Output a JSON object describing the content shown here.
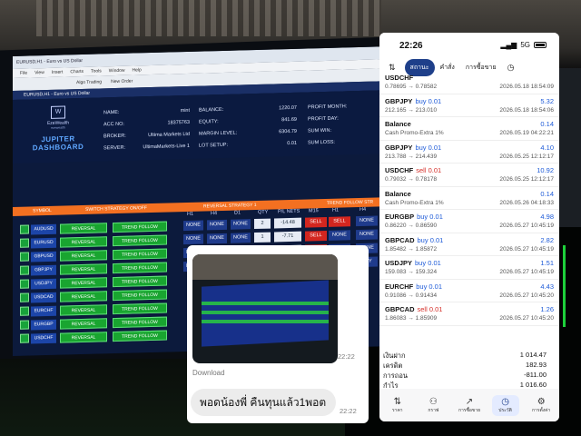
{
  "mt": {
    "title": "EURUSD,H1 - Euro vs US Dollar",
    "menu": [
      "File",
      "View",
      "Insert",
      "Charts",
      "Tools",
      "Window",
      "Help"
    ],
    "toolbar": [
      "Algo Trading",
      "New Order"
    ],
    "brand": "EzeWealth",
    "brand_sub": "ezewealth",
    "dashboard_title": "JUPITER DASHBOARD",
    "info_left": [
      {
        "k": "NAME:",
        "v": "mint"
      },
      {
        "k": "ACC NO:",
        "v": "18375763"
      },
      {
        "k": "BROKER:",
        "v": "Ultima Markets Ltd"
      },
      {
        "k": "SERVER:",
        "v": "UltimaMarkets-Live 1"
      }
    ],
    "info_mid": [
      {
        "k": "BALANCE:",
        "v": "1220.07"
      },
      {
        "k": "EQUITY:",
        "v": "841.69"
      },
      {
        "k": "MARGIN LEVEL:",
        "v": "6304.79"
      },
      {
        "k": "LOT SETUP:",
        "v": "0.01"
      }
    ],
    "info_right": [
      "PROFIT MONTH:",
      "PROFIT DAY:",
      "SUM WIN:",
      "SUM LOSS:"
    ],
    "symbol_label": "SYMBOL",
    "switch_label": "SWITCH STRATEGY ON/OFF",
    "reversal_label": "REVERSAL STRATEGY 1",
    "trend_label": "TREND FOLLOW STR",
    "columns": [
      "H1",
      "H4",
      "D1",
      "QTY",
      "P/L NETS",
      "M15",
      "H1",
      "H4"
    ],
    "rows": [
      {
        "sym": "AUDUSD",
        "a": "REVERSAL",
        "b": "TREND FOLLOW",
        "h1": "NONE",
        "h4": "NONE",
        "d1": "NONE",
        "qty": "2",
        "pl": "-14.48",
        "m15": "SELL",
        "t1": "SELL",
        "t4": "NONE"
      },
      {
        "sym": "EURUSD",
        "a": "REVERSAL",
        "b": "TREND FOLLOW",
        "h1": "NONE",
        "h4": "NONE",
        "d1": "NONE",
        "qty": "1",
        "pl": "-7.71",
        "m15": "SELL",
        "t1": "NONE",
        "t4": "NONE"
      },
      {
        "sym": "GBPUSD",
        "a": "REVERSAL",
        "b": "TREND FOLLOW",
        "h1": "NONE",
        "h4": "NONE",
        "d1": "NONE",
        "qty": "1",
        "pl": "-9.52",
        "m15": "SELL",
        "t1": "NONE",
        "t4": "NONE"
      },
      {
        "sym": "GBPJPY",
        "a": "REVERSAL",
        "b": "TREND FOLLOW",
        "h1": "NONE",
        "h4": "NONE",
        "d1": "NONE",
        "qty": "1",
        "pl": "-4.70",
        "m15": "SELL",
        "t1": "NONE",
        "t4": "BUY"
      },
      {
        "sym": "USDJPY",
        "a": "REVERSAL",
        "b": "TREND FOLLOW"
      },
      {
        "sym": "USDCAD",
        "a": "REVERSAL",
        "b": "TREND FOLLOW"
      },
      {
        "sym": "EURCHF",
        "a": "REVERSAL",
        "b": "TREND FOLLOW"
      },
      {
        "sym": "EURGBP",
        "a": "REVERSAL",
        "b": "TREND FOLLOW"
      },
      {
        "sym": "USDCHF",
        "a": "REVERSAL",
        "b": "TREND FOLLOW"
      }
    ]
  },
  "chat": {
    "photo_time": "22:22",
    "download_label": "Download",
    "message": "พอดน้องพี่ คืนทุนแล้ว1พอต",
    "message_time": "22:22"
  },
  "phone": {
    "time": "22:26",
    "signal": "5G",
    "tabs": [
      {
        "label": "สถานะ",
        "active": true
      },
      {
        "label": "คำสั่ง",
        "active": false
      },
      {
        "label": "การซื้อขาย",
        "active": false
      }
    ],
    "deals": [
      {
        "sym": "USDCHF",
        "side": "",
        "side_class": "",
        "prices": "0.78695 → 0.78582",
        "profit": "",
        "time": "2026.05.18 18:54:09"
      },
      {
        "sym": "GBPJPY",
        "side": "buy 0.01",
        "side_class": "buy",
        "prices": "212.165 → 213.010",
        "profit": "5.32",
        "time": "2026.05.18 18:54:06"
      },
      {
        "sym": "Balance",
        "side": "",
        "side_class": "",
        "prices": "Cash Promo-Extra 1%",
        "profit": "0.14",
        "time": "2026.05.19 04:22:21"
      },
      {
        "sym": "GBPJPY",
        "side": "buy 0.01",
        "side_class": "buy",
        "prices": "213.788 → 214.439",
        "profit": "4.10",
        "time": "2026.05.25 12:12:17"
      },
      {
        "sym": "USDCHF",
        "side": "sell 0.01",
        "side_class": "sell",
        "prices": "0.79032 → 0.78178",
        "profit": "10.92",
        "time": "2026.05.25 12:12:17"
      },
      {
        "sym": "Balance",
        "side": "",
        "side_class": "",
        "prices": "Cash Promo-Extra 1%",
        "profit": "0.14",
        "time": "2026.05.26 04:18:33"
      },
      {
        "sym": "EURGBP",
        "side": "buy 0.01",
        "side_class": "buy",
        "prices": "0.86220 → 0.86590",
        "profit": "4.98",
        "time": "2026.05.27 10:45:19"
      },
      {
        "sym": "GBPCAD",
        "side": "buy 0.01",
        "side_class": "buy",
        "prices": "1.85482 → 1.85872",
        "profit": "2.82",
        "time": "2026.05.27 10:45:19"
      },
      {
        "sym": "USDJPY",
        "side": "buy 0.01",
        "side_class": "buy",
        "prices": "159.083 → 159.324",
        "profit": "1.51",
        "time": "2026.05.27 10:45:19"
      },
      {
        "sym": "EURCHF",
        "side": "buy 0.01",
        "side_class": "buy",
        "prices": "0.91086 → 0.91434",
        "profit": "4.43",
        "time": "2026.05.27 10:45:20"
      },
      {
        "sym": "GBPCAD",
        "side": "sell 0.01",
        "side_class": "sell",
        "prices": "1.86083 → 1.85909",
        "profit": "1.26",
        "time": "2026.05.27 10:45:20"
      }
    ],
    "summary": [
      {
        "k": "เงินฝาก",
        "v": "1 014.47"
      },
      {
        "k": "เครดิต",
        "v": "182.93"
      },
      {
        "k": "การถอน",
        "v": "-811.00"
      },
      {
        "k": "กำไร",
        "v": "1 016.60"
      },
      {
        "k": "Swap",
        "v": "0.00"
      },
      {
        "k": "ค่าธรรมเนียม",
        "v": "0.00"
      },
      {
        "k": "Balance",
        "v": "1 403.00"
      }
    ],
    "nav": [
      {
        "label": "ราคา",
        "icon": "⇅"
      },
      {
        "label": "กราฟ",
        "icon": "⚇"
      },
      {
        "label": "การซื้อขาย",
        "icon": "↗"
      },
      {
        "label": "ประวัติ",
        "icon": "◷",
        "active": true
      },
      {
        "label": "การตั้งค่า",
        "icon": "⚙"
      }
    ]
  }
}
